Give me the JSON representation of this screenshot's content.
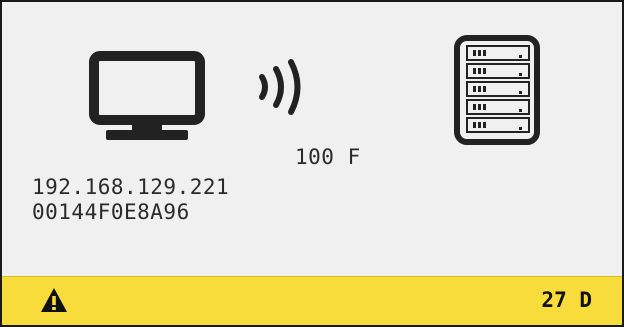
{
  "device": {
    "ip_address": "192.168.129.221",
    "mac_address": "00144F0E8A96"
  },
  "link": {
    "speed": "100 F"
  },
  "icons": {
    "client": "monitor-icon",
    "connection": "wireless-icon",
    "host": "server-icon",
    "status": "warning-icon"
  },
  "status_bar": {
    "badge": "27 D",
    "color": "#f7dc3c"
  }
}
